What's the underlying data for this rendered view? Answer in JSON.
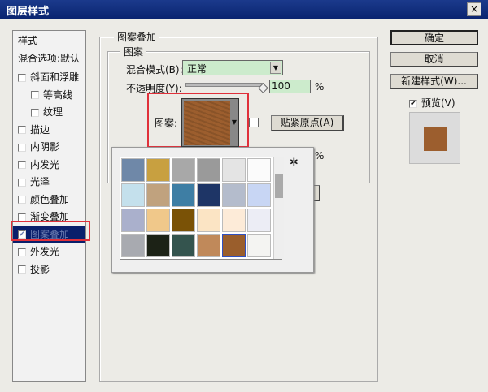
{
  "window": {
    "title": "图层样式",
    "close_label": "×"
  },
  "sidebar": {
    "header": "样式",
    "blend_options": "混合选项:默认",
    "items": [
      {
        "label": "斜面和浮雕",
        "checked": false
      },
      {
        "label": "等高线",
        "checked": false
      },
      {
        "label": "纹理",
        "checked": false
      },
      {
        "label": "描边",
        "checked": false
      },
      {
        "label": "内阴影",
        "checked": false
      },
      {
        "label": "内发光",
        "checked": false
      },
      {
        "label": "光泽",
        "checked": false
      },
      {
        "label": "颜色叠加",
        "checked": false
      },
      {
        "label": "渐变叠加",
        "checked": false
      },
      {
        "label": "图案叠加",
        "checked": true,
        "selected": true
      },
      {
        "label": "外发光",
        "checked": false
      },
      {
        "label": "投影",
        "checked": false
      }
    ]
  },
  "main": {
    "group_title": "图案叠加",
    "subgroup_title": "图案",
    "blend_mode_label": "混合模式(B):",
    "blend_mode_value": "正常",
    "opacity_label": "不透明度(Y):",
    "opacity_value": "100",
    "opacity_unit": "%",
    "pattern_label": "图案:",
    "snap_button": "贴紧原点(A)",
    "scale_unit": "%",
    "pattern_colors": [
      "#6f88a8",
      "#c8a040",
      "#a8a8a8",
      "#9a9a9a",
      "#e4e4e4",
      "#fbfbfb",
      "#c4e0ec",
      "#c0a27e",
      "#3e7ea4",
      "#1e3566",
      "#b4bccc",
      "#c8d6f4",
      "#aab0cc",
      "#f0c88a",
      "#7a5206",
      "#fbe4c4",
      "#fdebd8",
      "#ecedf5",
      "#a8aab0",
      "#1c2216",
      "#34544e",
      "#c0895a",
      "#9a5e2c",
      "#f4f4f2"
    ],
    "selected_pattern_color": "#9c5e2e"
  },
  "actions": {
    "ok": "确定",
    "cancel": "取消",
    "new_style": "新建样式(W)...",
    "preview_label": "预览(V)",
    "preview_checked": true
  }
}
